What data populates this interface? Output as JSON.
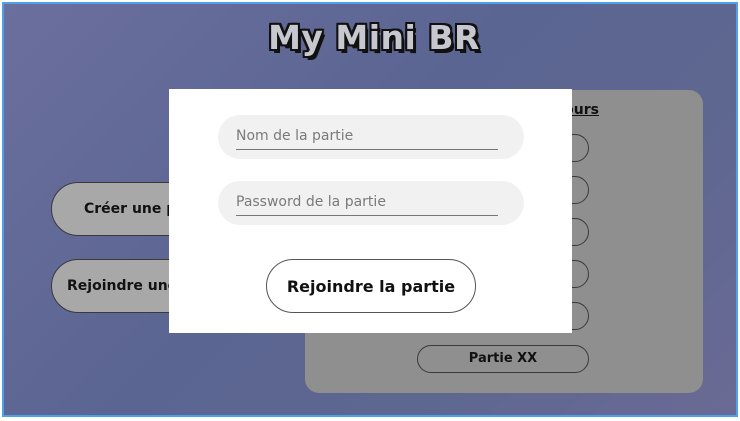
{
  "app": {
    "title": "My Mini BR"
  },
  "menu": {
    "create_label": "Créer une partie",
    "join_label": "Rejoindre une partie"
  },
  "games_panel": {
    "heading": "Parties en cours",
    "slots": [
      {
        "label": ""
      },
      {
        "label": ""
      },
      {
        "label": ""
      },
      {
        "label": ""
      },
      {
        "label": ""
      },
      {
        "label": "Partie XX"
      }
    ]
  },
  "join_dialog": {
    "name_placeholder": "Nom de la partie",
    "password_placeholder": "Password de la partie",
    "submit_label": "Rejoindre la partie"
  },
  "colors": {
    "frame_border": "#4ea1e6",
    "background": "#5d6790",
    "panel": "#8f8f8f",
    "modal": "#ffffff"
  }
}
